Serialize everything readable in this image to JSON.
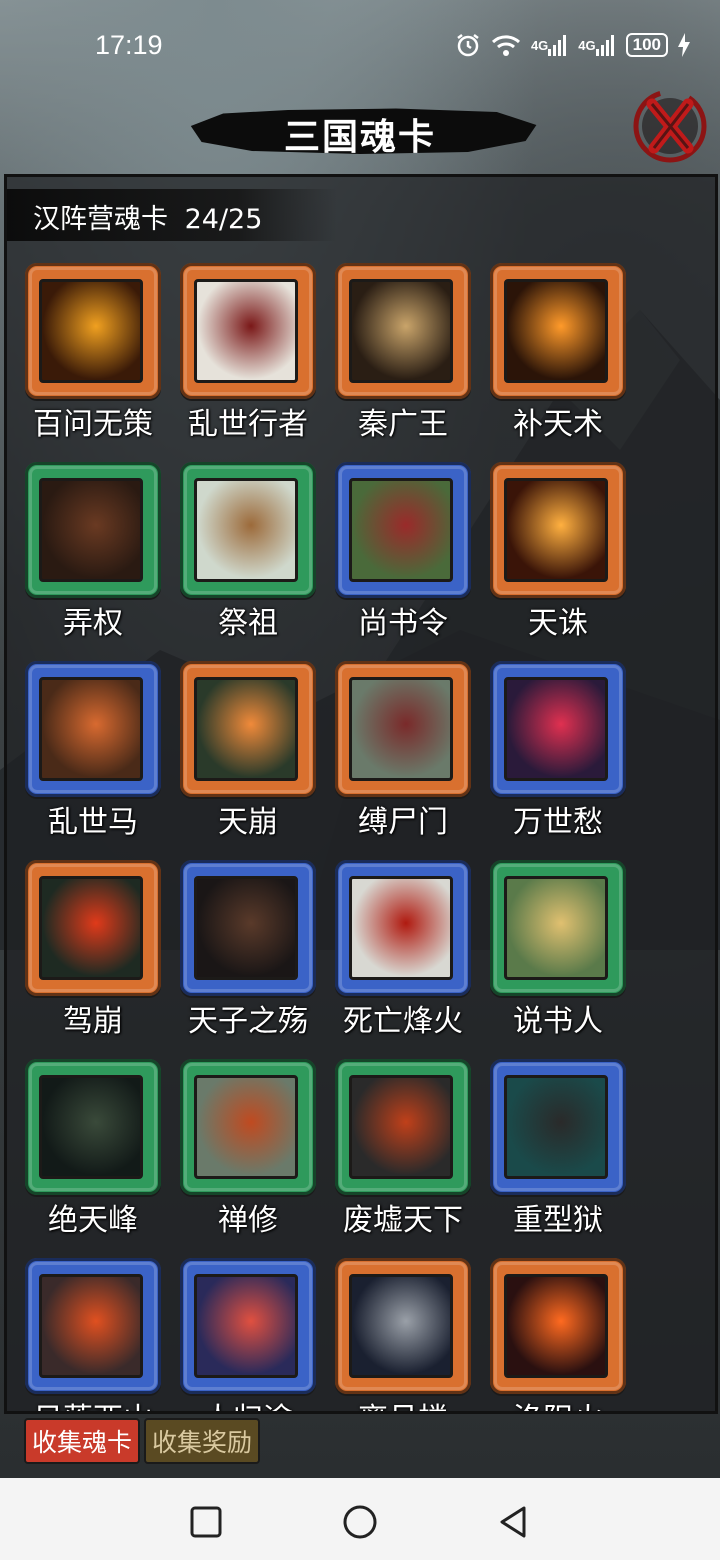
{
  "status_bar": {
    "time": "17:19",
    "network_1": "4G",
    "network_2": "4G",
    "battery": "100"
  },
  "header": {
    "title": "三国魂卡"
  },
  "panel": {
    "camp_label": "汉阵营魂卡",
    "progress": "24/25"
  },
  "colors": {
    "orange_frame": "#d9702f",
    "green_frame": "#2f9a5c",
    "blue_frame": "#3b63c7",
    "active_tab": "#c93a2a",
    "inactive_tab": "#5a4a22"
  },
  "cards": [
    {
      "name": "百问无策",
      "frame": "orange"
    },
    {
      "name": "乱世行者",
      "frame": "orange"
    },
    {
      "name": "秦广王",
      "frame": "orange"
    },
    {
      "name": "补天术",
      "frame": "orange"
    },
    {
      "name": "弄权",
      "frame": "green"
    },
    {
      "name": "祭祖",
      "frame": "green"
    },
    {
      "name": "尚书令",
      "frame": "blue"
    },
    {
      "name": "天诛",
      "frame": "orange"
    },
    {
      "name": "乱世马",
      "frame": "blue"
    },
    {
      "name": "天崩",
      "frame": "orange"
    },
    {
      "name": "缚尸门",
      "frame": "orange"
    },
    {
      "name": "万世愁",
      "frame": "blue"
    },
    {
      "name": "驾崩",
      "frame": "orange"
    },
    {
      "name": "天子之殇",
      "frame": "blue"
    },
    {
      "name": "死亡烽火",
      "frame": "blue"
    },
    {
      "name": "说书人",
      "frame": "green"
    },
    {
      "name": "绝天峰",
      "frame": "green"
    },
    {
      "name": "禅修",
      "frame": "green"
    },
    {
      "name": "废墟天下",
      "frame": "green"
    },
    {
      "name": "重型狱",
      "frame": "blue"
    },
    {
      "name": "日落西山",
      "frame": "blue"
    },
    {
      "name": "人归途",
      "frame": "blue"
    },
    {
      "name": "离月楼",
      "frame": "orange"
    },
    {
      "name": "洛阳火",
      "frame": "orange"
    }
  ],
  "tabs": {
    "collect_cards": "收集魂卡",
    "collect_rewards": "收集奖励"
  },
  "nav": {
    "recent_icon": "square-icon",
    "home_icon": "circle-icon",
    "back_icon": "triangle-back-icon"
  }
}
